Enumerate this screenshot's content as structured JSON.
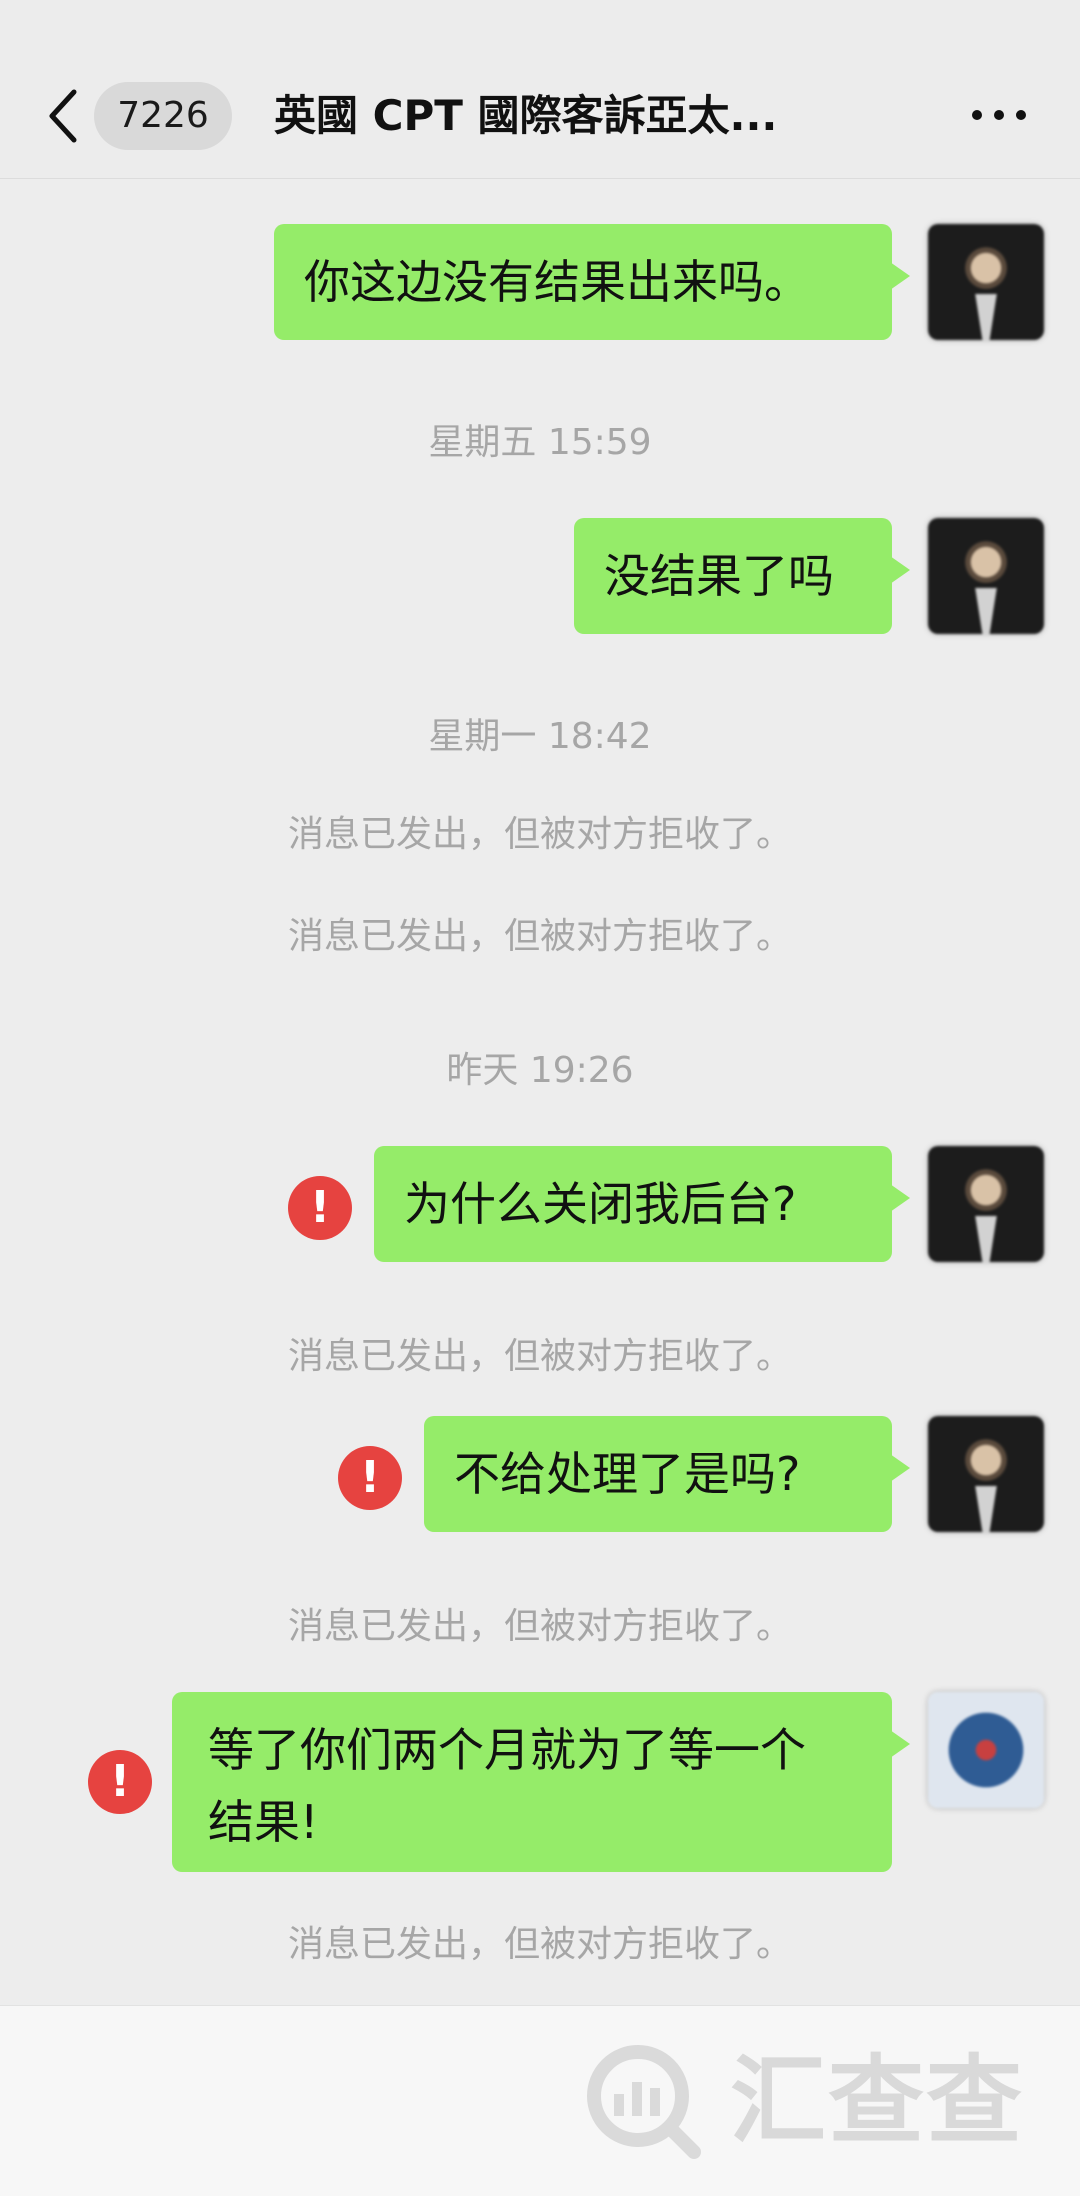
{
  "header": {
    "unread_count": "7226",
    "title": "英國 CPT 國際客訴亞太..."
  },
  "messages": [
    {
      "text": "你这边没有结果出来吗。"
    },
    {
      "text": "没结果了吗"
    },
    {
      "text": "为什么关闭我后台?"
    },
    {
      "text": "不给处理了是吗?"
    },
    {
      "text": "等了你们两个月就为了等一个\n结果!"
    }
  ],
  "timestamps": [
    "星期五 15:59",
    "星期一 18:42",
    "昨天 19:26"
  ],
  "notices": {
    "rejected": "消息已发出，但被对方拒收了。"
  },
  "icons": {
    "back": "chevron-left-icon",
    "more": "more-dots-icon",
    "error": "exclamation-icon",
    "error_glyph": "!"
  },
  "watermark": {
    "brand": "汇查查"
  },
  "colors": {
    "bubble": "#95ec69",
    "background": "#ededed",
    "error": "#e64340",
    "notice_text": "#a6a6a6"
  }
}
